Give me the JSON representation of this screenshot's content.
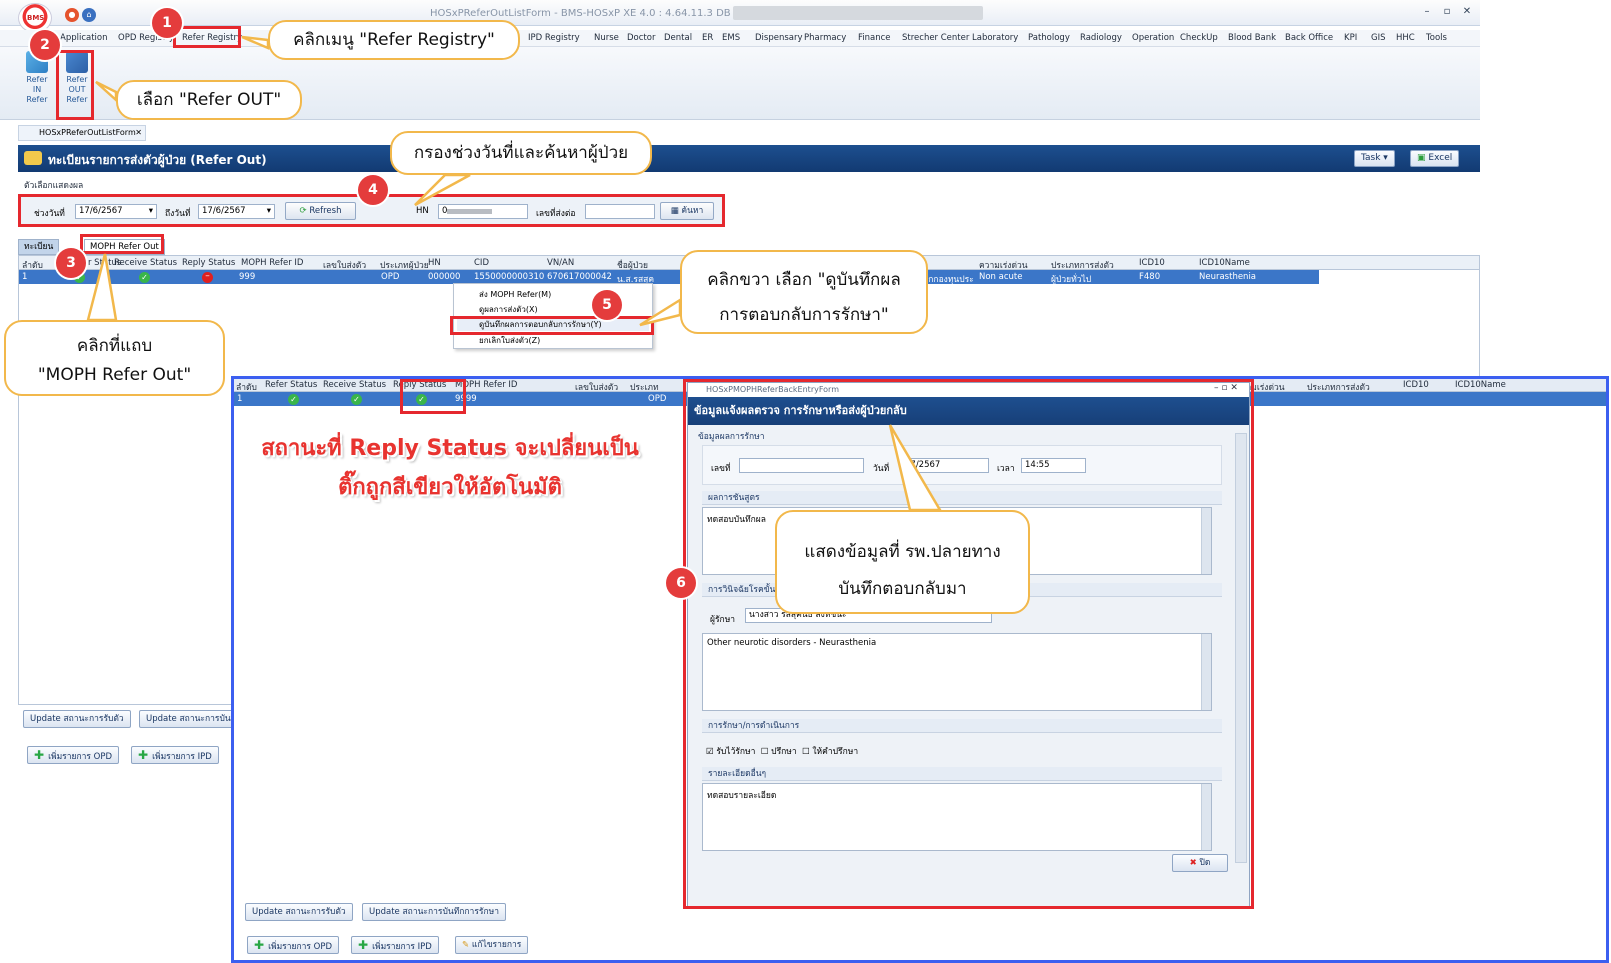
{
  "window": {
    "title": "HOSxPReferOutListForm - BMS-HOSxP XE 4.0 : 4.64.11.3 DB :",
    "logo_text": "BMS"
  },
  "menu": [
    "Application",
    "OPD Registry",
    "Refer Registry",
    "IPD Registry",
    "Nurse",
    "Doctor",
    "Dental",
    "ER",
    "EMS",
    "Dispensary",
    "Pharmacy",
    "Finance",
    "Strecher Center",
    "Laboratory",
    "Pathology",
    "Radiology",
    "Operation",
    "CheckUp",
    "Blood Bank",
    "Back Office",
    "KPI",
    "GIS",
    "HHC",
    "Tools"
  ],
  "ribbon": {
    "refer_in": [
      "Refer",
      "IN",
      "Refer"
    ],
    "refer_out": [
      "Refer",
      "OUT",
      "Refer"
    ]
  },
  "doc_tab": "HOSxPReferOutListForm",
  "header": {
    "title": "ทะเบียนรายการส่งตัวผู้ป่วย (Refer Out)",
    "task": "Task",
    "excel": "Excel"
  },
  "filter": {
    "section": "ตัวเลือกแสดงผล",
    "from_label": "ช่วงวันที่",
    "from_value": "17/6/2567",
    "to_label": "ถึงวันที่",
    "to_value": "17/6/2567",
    "refresh": "Refresh",
    "hn_label": "HN",
    "hn_value": "0",
    "refer_no_label": "เลขที่ส่งต่อ",
    "refer_no_value": "",
    "search": "ค้นหา"
  },
  "tabs": {
    "tab1": "ทะเบียน",
    "tab2": "MOPH Refer Out"
  },
  "grid": {
    "columns": [
      "ลำดับ",
      "Refer Status",
      "Receive Status",
      "Reply Status",
      "MOPH Refer ID",
      "เลขใบส่งตัว",
      "ประเภทผู้ป่วย",
      "HN",
      "CID",
      "VN/AN",
      "ชื่อผู้ป่วย",
      "สิทธิ",
      "ความเร่งด่วน",
      "ประเภทการส่งตัว",
      "ICD10",
      "ICD10Name"
    ],
    "row": {
      "no": "1",
      "moph_id": "999",
      "type": "OPD",
      "hn": "000000",
      "cid": "1550000000310",
      "vn": "670617000042",
      "name": "น.ส.รสสุค",
      "right": "สิทธิเบิกกองทุนประ",
      "urgency": "Non acute",
      "refer_type": "ผู้ป่วยทั่วไป",
      "icd10": "F480",
      "icd10name": "Neurasthenia"
    }
  },
  "context_menu": [
    "ส่ง MOPH Refer(M)",
    "ดูผลการส่งตัว(X)",
    "ดูบันทึกผลการตอบกลับการรักษา(Y)",
    "ยกเลิกใบส่งตัว(Z)"
  ],
  "bottom_buttons": {
    "update_receive": "Update สถานะการรับตัว",
    "update_treat": "Update สถานะการบันทึกการรักษา",
    "add_opd": "เพิ่มรายการ OPD",
    "add_ipd": "เพิ่มรายการ IPD",
    "edit": "แก้ไขรายการ"
  },
  "second_grid": {
    "columns": [
      "ลำดับ",
      "Refer Status",
      "Receive Status",
      "Reply Status",
      "MOPH Refer ID",
      "เลขใบส่งตัว",
      "ประเภท",
      "ความเร่งด่วน",
      "ประเภทการส่งตัว",
      "ICD10",
      "ICD10Name"
    ],
    "row": {
      "no": "1",
      "moph_id": "9999",
      "type": "OPD"
    }
  },
  "dialog": {
    "titlebar": "HOSxPMOPHReferBackEntryForm",
    "title": "ข้อมูลแจ้งผลตรวจ การรักษาหรือส่งผู้ป่วยกลับ",
    "section_info": "ข้อมูลผลการรักษา",
    "no_label": "เลขที่",
    "date_label": "วันที่",
    "date_value": "07/2567",
    "time_label": "เวลา",
    "time_value": "14:55",
    "lab_section": "ผลการชันสูตร",
    "lab_text": "ทดสอบบันทึกผล",
    "diag_section": "การวินิจฉัยโรคขั้นสุดท้าย",
    "doctor_label": "ผู้รักษา",
    "doctor_value": "นางสาว รสสุคนธ์ สิงห์ชนะ",
    "diag_text": "Other neurotic disorders - Neurasthenia",
    "treat_section": "การรักษา/การดำเนินการ",
    "opt1": "รับไว้รักษา",
    "opt2": "ปรึกษา",
    "opt3": "ให้คำปรึกษา",
    "detail_section": "รายละเอียดอื่นๆ",
    "detail_text": "ทดสอบรายละเอียด",
    "close": "ปิด"
  },
  "annotations": {
    "c1": "คลิกเมนู \"Refer Registry\"",
    "c2": "เลือก \"Refer OUT\"",
    "c3a": "คลิกที่แถบ",
    "c3b": "\"MOPH Refer Out\"",
    "c4": "กรองช่วงวันที่และค้นหาผู้ป่วย",
    "c5a": "คลิกขวา เลือก \"ดูบันทึกผล",
    "c5b": "การตอบกลับการรักษา\"",
    "c6a": "แสดงข้อมูลที่ รพ.ปลายทาง",
    "c6b": "บันทึกตอบกลับมา",
    "status_a": "สถานะที่ Reply Status จะเปลี่ยนเป็น",
    "status_b": "ติ๊กถูกสีเขียวให้อัตโนมัติ",
    "n1": "1",
    "n2": "2",
    "n3": "3",
    "n4": "4",
    "n5": "5",
    "n6": "6"
  }
}
